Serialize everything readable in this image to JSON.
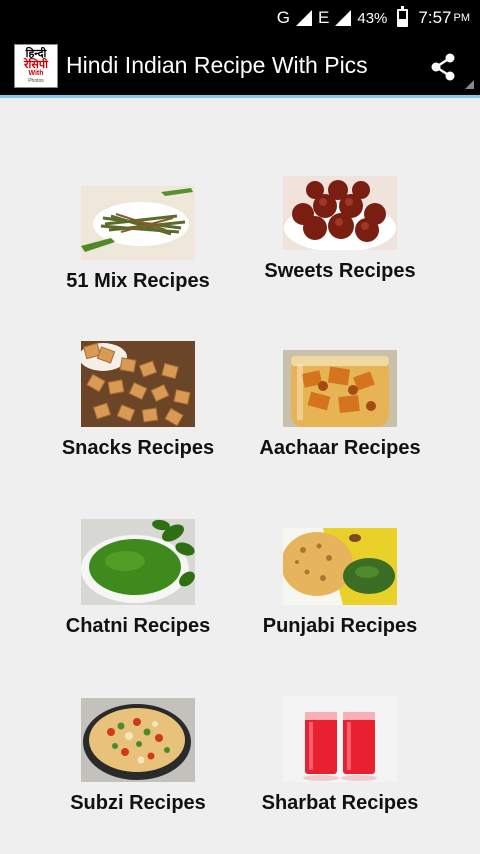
{
  "status_bar": {
    "network1": "G",
    "network2": "E",
    "battery": "43%",
    "battery_level": 0.43,
    "time": "7:57",
    "ampm": "PM"
  },
  "app_bar": {
    "title": "Hindi Indian Recipe With Pics",
    "logo_line1": "हिन्दी",
    "logo_line2": "रेसिपी",
    "logo_line3": "With",
    "logo_line4": "Photos",
    "share_icon": "share-icon"
  },
  "categories": [
    {
      "label": "51 Mix Recipes",
      "image": "mix-recipes-photo"
    },
    {
      "label": "Sweets Recipes",
      "image": "sweets-photo"
    },
    {
      "label": "Snacks Recipes",
      "image": "snacks-photo"
    },
    {
      "label": "Aachaar Recipes",
      "image": "aachaar-photo"
    },
    {
      "label": "Chatni Recipes",
      "image": "chatni-photo"
    },
    {
      "label": "Punjabi Recipes",
      "image": "punjabi-photo"
    },
    {
      "label": "Subzi Recipes",
      "image": "subzi-photo"
    },
    {
      "label": "Sharbat Recipes",
      "image": "sharbat-photo"
    }
  ]
}
